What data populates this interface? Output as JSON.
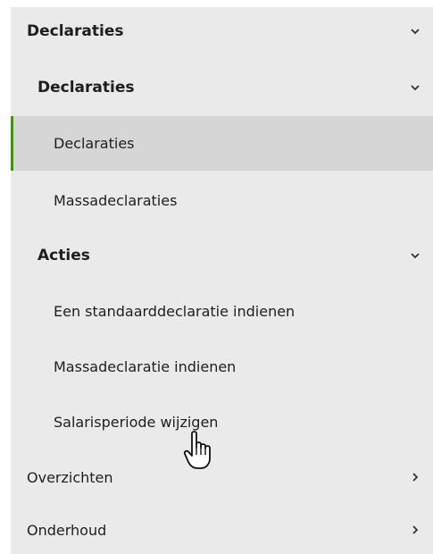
{
  "nav": {
    "section": {
      "label": "Declaraties",
      "chevron": "chevron-down-icon"
    },
    "group_declaraties": {
      "label": "Declaraties",
      "chevron": "chevron-down-icon"
    },
    "items_declaraties": [
      {
        "label": "Declaraties",
        "active": true
      },
      {
        "label": "Massadeclaraties",
        "active": false
      }
    ],
    "group_acties": {
      "label": "Acties",
      "chevron": "chevron-down-icon"
    },
    "items_acties": [
      {
        "label": "Een standaarddeclaratie indienen"
      },
      {
        "label": "Massadeclaratie indienen"
      },
      {
        "label": "Salarisperiode wijzigen"
      }
    ],
    "overzichten": {
      "label": "Overzichten",
      "chevron": "chevron-right-icon"
    },
    "onderhoud": {
      "label": "Onderhoud",
      "chevron": "chevron-right-icon"
    }
  },
  "colors": {
    "panel_bg": "#eaeaea",
    "active_bg": "#d6d6d6",
    "active_accent": "#4a8d1f",
    "text": "#1e1e1e"
  },
  "cursor": "hand-pointer-icon"
}
